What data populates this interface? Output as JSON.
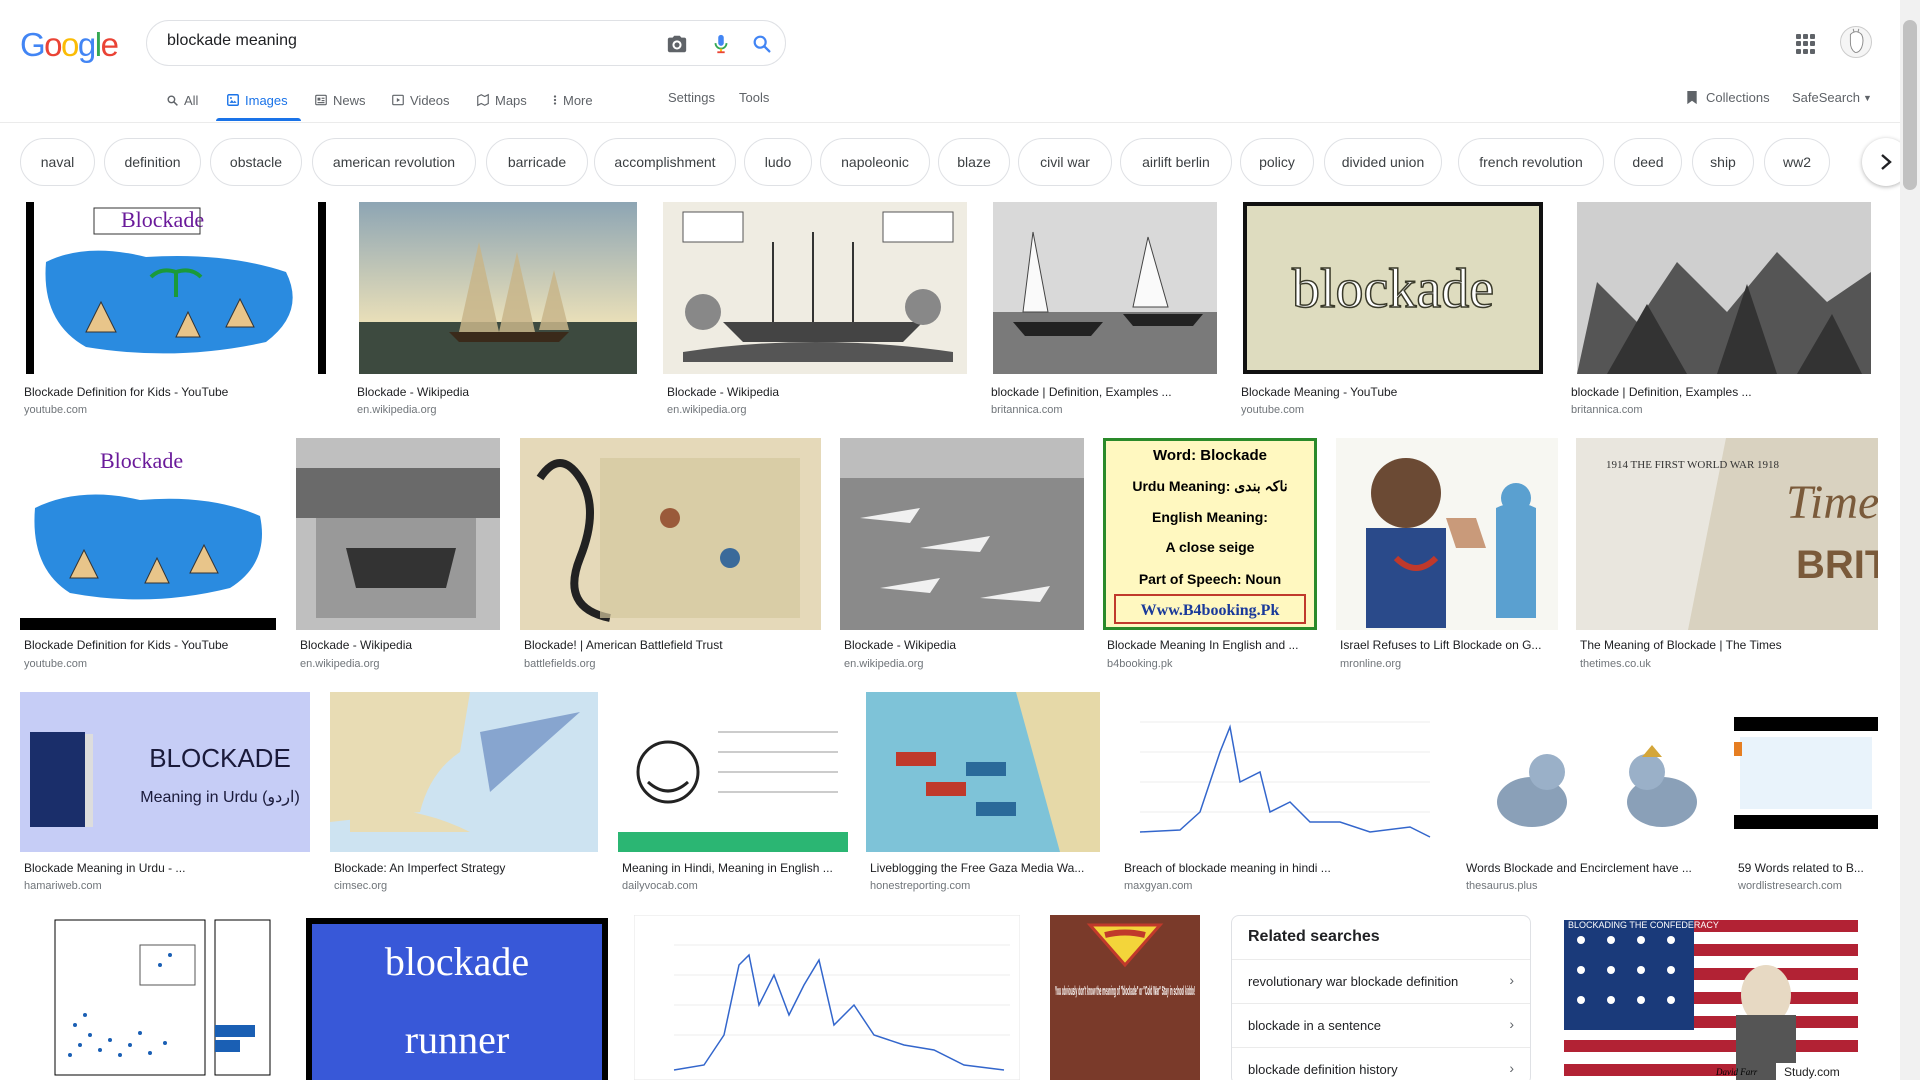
{
  "search": {
    "query": "blockade meaning"
  },
  "logo": {
    "letters": [
      "G",
      "o",
      "o",
      "g",
      "l",
      "e"
    ],
    "colors": [
      "#4285f4",
      "#ea4335",
      "#fbbc05",
      "#4285f4",
      "#34a853",
      "#ea4335"
    ]
  },
  "tabs": [
    {
      "label": "All",
      "icon": "search-icon"
    },
    {
      "label": "Images",
      "icon": "image-icon",
      "active": true
    },
    {
      "label": "News",
      "icon": "news-icon"
    },
    {
      "label": "Videos",
      "icon": "video-icon"
    },
    {
      "label": "Maps",
      "icon": "map-icon"
    },
    {
      "label": "More",
      "icon": "more-vert-icon"
    }
  ],
  "nav_tools": {
    "settings": "Settings",
    "tools": "Tools"
  },
  "nav_right": {
    "collections": "Collections",
    "safesearch": "SafeSearch"
  },
  "chips": [
    "naval",
    "definition",
    "obstacle",
    "american revolution",
    "barricade",
    "accomplishment",
    "ludo",
    "napoleonic",
    "blaze",
    "civil war",
    "airlift berlin",
    "policy",
    "divided union",
    "french revolution",
    "deed",
    "ship",
    "ww2"
  ],
  "results": [
    {
      "title": "Blockade Definition for Kids - YouTube",
      "source": "youtube.com"
    },
    {
      "title": "Blockade - Wikipedia",
      "source": "en.wikipedia.org"
    },
    {
      "title": "Blockade - Wikipedia",
      "source": "en.wikipedia.org"
    },
    {
      "title": "blockade | Definition, Examples ...",
      "source": "britannica.com"
    },
    {
      "title": "Blockade Meaning - YouTube",
      "source": "youtube.com"
    },
    {
      "title": "blockade | Definition, Examples ...",
      "source": "britannica.com"
    },
    {
      "title": "Blockade Definition for Kids - YouTube",
      "source": "youtube.com"
    },
    {
      "title": "Blockade - Wikipedia",
      "source": "en.wikipedia.org"
    },
    {
      "title": "Blockade! | American Battlefield Trust",
      "source": "battlefields.org"
    },
    {
      "title": "Blockade - Wikipedia",
      "source": "en.wikipedia.org"
    },
    {
      "title": "Blockade Meaning In English and ...",
      "source": "b4booking.pk"
    },
    {
      "title": "Israel Refuses to Lift Blockade on G...",
      "source": "mronline.org"
    },
    {
      "title": "The Meaning of Blockade | The Times",
      "source": "thetimes.co.uk"
    },
    {
      "title": "Blockade Meaning in Urdu - ...",
      "source": "hamariweb.com"
    },
    {
      "title": "Blockade: An Imperfect Strategy",
      "source": "cimsec.org"
    },
    {
      "title": "Meaning in Hindi, Meaning in English ...",
      "source": "dailyvocab.com"
    },
    {
      "title": "Liveblogging the Free Gaza Media Wa...",
      "source": "honestreporting.com"
    },
    {
      "title": "Breach of blockade meaning in hindi ...",
      "source": "maxgyan.com"
    },
    {
      "title": "Words Blockade and Encirclement have ...",
      "source": "thesaurus.plus"
    },
    {
      "title": "59 Words related to B...",
      "source": "wordlistresearch.com"
    }
  ],
  "image_text": {
    "blockade_word": "blockade",
    "kids_board": "Blockade",
    "urdu_title": "BLOCKADE",
    "urdu_sub": "Meaning in Urdu (اردو)",
    "b4_word": "Word: Blockade",
    "b4_urdu": "Urdu Meaning: ناکہ بندی",
    "b4_english": "English Meaning:",
    "b4_siege": "A close seige",
    "b4_pos": "Part of Speech: Noun",
    "b4_site": "Www.B4booking.Pk",
    "runner_1": "blockade",
    "runner_2": "runner",
    "superman": "You obviously don't know the meaning of \"blockade\" or \"Cold War\" Stay in school kiddo!",
    "confed": "BLOCKADING THE CONFEDERACY",
    "study": "Study.com",
    "times_word": "Times",
    "times_sub": "BRITA",
    "times_year": "1914 THE FIRST WORLD WAR 1918",
    "fullname": "David Farr"
  },
  "related": {
    "heading": "Related searches",
    "items": [
      "revolutionary war blockade definition",
      "blockade in a sentence",
      "blockade definition history"
    ]
  }
}
